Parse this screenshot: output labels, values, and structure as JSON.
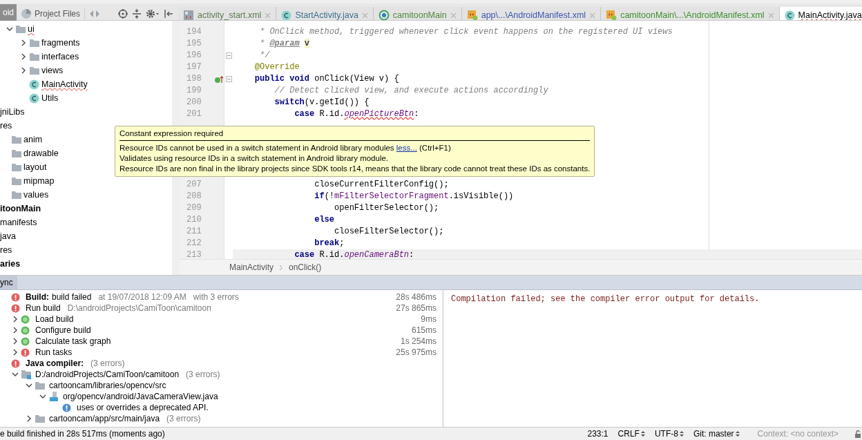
{
  "tool_window": {
    "tab_label": "oid",
    "view_label": "Project Files"
  },
  "editor_tabs": [
    {
      "label": "activity_start.xml",
      "kind": "xml",
      "color": "#5c7a52",
      "selected": false
    },
    {
      "label": "StartActivity.java",
      "kind": "class",
      "color": "#3a6f8f",
      "selected": false
    },
    {
      "label": "camitoonMain",
      "kind": "module",
      "color": "#4b8a3c",
      "selected": false
    },
    {
      "label": "app\\...\\AndroidManifest.xml",
      "kind": "manifest",
      "color": "#3b55b0",
      "selected": false
    },
    {
      "label": "camitoonMain\\...\\AndroidManifest.xml",
      "kind": "manifest",
      "color": "#3d8f2e",
      "selected": false
    },
    {
      "label": "MainActivity.java",
      "kind": "class",
      "color": "#000000",
      "selected": true,
      "error": true
    }
  ],
  "project_tree_head": [
    {
      "label": "ui",
      "kind": "folder",
      "expanded": true,
      "error": true,
      "children": [
        {
          "label": "fragments",
          "kind": "folder",
          "expanded": false
        },
        {
          "label": "interfaces",
          "kind": "folder",
          "expanded": false
        },
        {
          "label": "views",
          "kind": "folder",
          "expanded": false
        },
        {
          "label": "MainActivity",
          "kind": "class",
          "error": true
        },
        {
          "label": "Utils",
          "kind": "class"
        }
      ]
    }
  ],
  "project_tree": [
    {
      "label": "jniLibs"
    },
    {
      "label": "res",
      "children": [
        {
          "label": "anim",
          "kind": "folder"
        },
        {
          "label": "drawable",
          "kind": "folder"
        },
        {
          "label": "layout",
          "kind": "folder"
        },
        {
          "label": "mipmap",
          "kind": "folder"
        },
        {
          "label": "values",
          "kind": "folder"
        }
      ]
    },
    {
      "label": "itoonMain",
      "bold": true
    },
    {
      "label": "manifests"
    },
    {
      "label": "java"
    },
    {
      "label": "res"
    },
    {
      "label": "aries",
      "bold": true
    }
  ],
  "code_lines": [
    {
      "kind": "code",
      "number": "194",
      "tokens": [
        {
          "kind": "cm",
          "text": "     * OnClick method, triggered whenever click event happens on the registered UI views"
        }
      ]
    },
    {
      "kind": "code",
      "number": "195",
      "tokens": [
        {
          "kind": "cm",
          "text": "     * "
        },
        {
          "kind": "doc",
          "text": "@param"
        },
        {
          "kind": "param",
          "text": "v"
        }
      ]
    },
    {
      "kind": "code",
      "number": "196",
      "fold": true,
      "tokens": [
        {
          "kind": "cm",
          "text": "     */"
        }
      ]
    },
    {
      "kind": "code",
      "number": "197",
      "tokens": [
        {
          "kind": "ann",
          "text": "    @Override"
        }
      ]
    },
    {
      "kind": "override",
      "number": "198",
      "fold": true,
      "tokens": [
        {
          "kind": "kw",
          "text": "    public void"
        },
        {
          "kind": "plain",
          "text": " onClick(View v) {"
        }
      ]
    },
    {
      "kind": "code",
      "number": "199",
      "tokens": [
        {
          "kind": "cm",
          "text": "        // Detect clicked view, and execute actions accordingly"
        }
      ]
    },
    {
      "kind": "code",
      "number": "200",
      "tokens": [
        {
          "kind": "kw",
          "text": "        switch"
        },
        {
          "kind": "plain",
          "text": "(v.getId()) {"
        }
      ]
    },
    {
      "kind": "code",
      "number": "201",
      "tokens": [
        {
          "kind": "kw",
          "text": "            case"
        },
        {
          "kind": "plain",
          "text": " R.id."
        },
        {
          "kind": "err",
          "text": "openPictureBtn"
        },
        {
          "kind": "plain",
          "text": ":"
        }
      ]
    },
    {
      "kind": "covered"
    },
    {
      "kind": "covered"
    },
    {
      "kind": "covered"
    },
    {
      "kind": "covered"
    },
    {
      "kind": "covered"
    },
    {
      "kind": "code",
      "number": "207",
      "tokens": [
        {
          "kind": "plain",
          "text": "                closeCurrentFilterConfig();"
        }
      ]
    },
    {
      "kind": "code",
      "number": "208",
      "tokens": [
        {
          "kind": "kw",
          "text": "                if"
        },
        {
          "kind": "plain",
          "text": "(!"
        },
        {
          "kind": "field",
          "text": "mFilterSelectorFragment"
        },
        {
          "kind": "plain",
          "text": ".isVisible())"
        }
      ]
    },
    {
      "kind": "code",
      "number": "209",
      "tokens": [
        {
          "kind": "plain",
          "text": "                    openFilterSelector();"
        }
      ]
    },
    {
      "kind": "code",
      "number": "210",
      "tokens": [
        {
          "kind": "kw",
          "text": "                else"
        }
      ]
    },
    {
      "kind": "code",
      "number": "211",
      "tokens": [
        {
          "kind": "plain",
          "text": "                    closeFilterSelector();"
        }
      ]
    },
    {
      "kind": "code",
      "number": "212",
      "tokens": [
        {
          "kind": "kw",
          "text": "                break"
        },
        {
          "kind": "plain",
          "text": ";"
        }
      ]
    },
    {
      "kind": "code",
      "number": "213",
      "current": true,
      "tokens": [
        {
          "kind": "kw",
          "text": "            case"
        },
        {
          "kind": "plain",
          "text": " R.id."
        },
        {
          "kind": "sfield",
          "text": "openCameraBtn"
        },
        {
          "kind": "plain",
          "text": ":"
        }
      ]
    }
  ],
  "tooltip": {
    "title": "Constant expression required",
    "line_1": "Resource IDs cannot be used in a switch statement in Android library modules",
    "link": "less...",
    "shortcut": "(Ctrl+F1)",
    "line_2": "Validates using resource IDs in a switch statement in Android library module.",
    "line_3": "Resource IDs are non final in the library projects since SDK tools r14, means that the library code cannot treat these IDs as constants."
  },
  "breadcrumbs": [
    "MainActivity",
    "onClick()"
  ],
  "build_panel": {
    "tab_label": "ync",
    "tree": [
      {
        "kind": "error",
        "label": "Build:",
        "bold": true,
        "label_2": "build failed",
        "notes": [
          "at 19/07/2018 12:09 AM",
          "with 3 errors"
        ],
        "time": "28s 486ms",
        "children": [
          {
            "kind": "error",
            "label": "Run build",
            "notes": [
              "D:\\androidProjects\\CamiToon\\camitoon"
            ],
            "time": "27s 865ms",
            "children": [
              {
                "kind": "ok",
                "label": "Load build",
                "time": "9ms",
                "expanded": false
              },
              {
                "kind": "ok",
                "label": "Configure build",
                "time": "615ms",
                "expanded": false
              },
              {
                "kind": "ok",
                "label": "Calculate task graph",
                "time": "1s 254ms",
                "expanded": false
              },
              {
                "kind": "error",
                "label": "Run tasks",
                "time": "25s 975ms",
                "expanded": false
              }
            ]
          },
          {
            "kind": "error",
            "label": "Java compiler:",
            "bold": true,
            "notes": [
              "(3 errors)"
            ],
            "children": [
              {
                "kind": "modulefolder",
                "label": "D:/androidProjects/CamiToon/camitoon",
                "notes": [
                  "(3 errors)"
                ],
                "expanded": true,
                "children": [
                  {
                    "kind": "folder",
                    "label": "cartooncam/libraries/opencv/src",
                    "expanded": true,
                    "children": [
                      {
                        "kind": "javafile",
                        "label": "org/opencv/android/JavaCameraView.java",
                        "expanded": true,
                        "children": [
                          {
                            "kind": "info",
                            "label": "uses or overrides a deprecated API."
                          }
                        ]
                      }
                    ]
                  },
                  {
                    "kind": "folder",
                    "label": "cartooncam/app/src/main/java",
                    "notes": [
                      "(3 errors)"
                    ],
                    "expanded": false
                  }
                ]
              }
            ]
          }
        ]
      }
    ],
    "output": "Compilation failed; see the compiler error output for details."
  },
  "status_bar": {
    "message": "e build finished in 28s 517ms (moments ago)",
    "items": [
      {
        "kind": "plain",
        "text": "233:1"
      },
      {
        "kind": "dropdown",
        "text": "CRLF"
      },
      {
        "kind": "dropdown",
        "text": "UTF-8"
      },
      {
        "kind": "dropdown",
        "text": "Git: master"
      },
      {
        "kind": "muted",
        "text": "Context: <no context>"
      }
    ]
  }
}
